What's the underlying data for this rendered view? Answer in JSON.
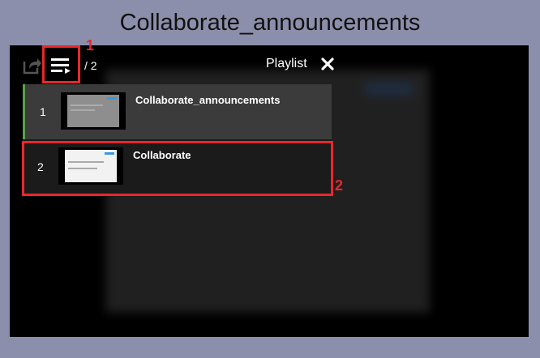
{
  "page": {
    "title": "Collaborate_announcements"
  },
  "player": {
    "counter": "/ 2",
    "playlist_label": "Playlist",
    "items": [
      {
        "num": "1",
        "title": "Collaborate_announcements",
        "active": true
      },
      {
        "num": "2",
        "title": "Collaborate",
        "active": false
      }
    ]
  },
  "annotations": {
    "a1": "1",
    "a2": "2"
  },
  "colors": {
    "background": "#8c8fab",
    "annotation": "#e8282b",
    "active_bar": "#5aa04a"
  },
  "icons": {
    "share": "share-icon",
    "playlist": "playlist-icon",
    "close": "close-icon"
  }
}
